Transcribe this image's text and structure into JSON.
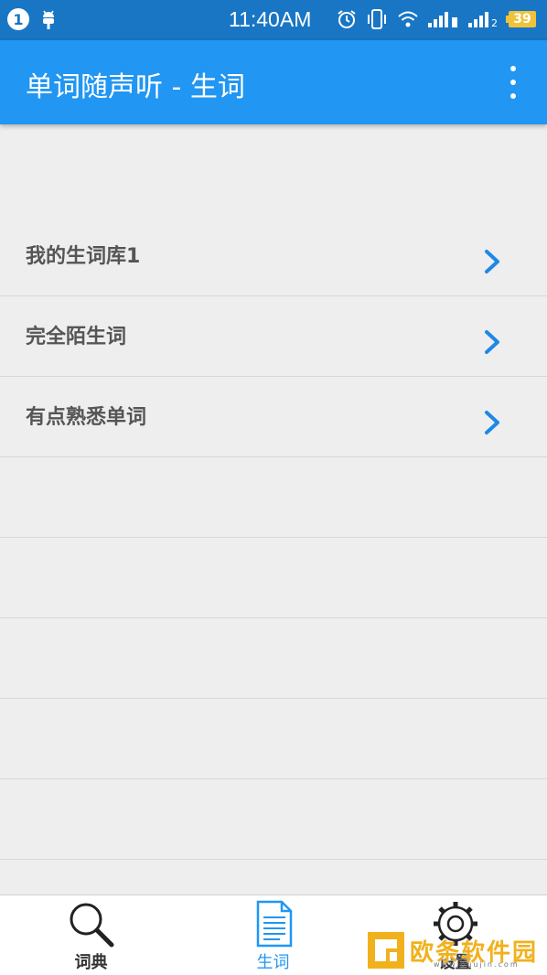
{
  "statusbar": {
    "notification_count": "1",
    "time": "11:40AM",
    "battery": "39",
    "sim2_label": "2",
    "icons": [
      "android-icon",
      "alarm-icon",
      "vibrate-icon",
      "wifi-icon",
      "signal-icon",
      "battery-icon"
    ]
  },
  "appbar": {
    "title": "单词随声听 - 生词",
    "menu_icon": "overflow-menu-icon",
    "background": "#2196f3"
  },
  "list": {
    "items": [
      {
        "label": "我的生词库1"
      },
      {
        "label": "完全陌生词"
      },
      {
        "label": "有点熟悉单词"
      }
    ],
    "chevron_color": "#1e88e5"
  },
  "bottomnav": {
    "tabs": [
      {
        "label": "词典",
        "icon": "search-icon"
      },
      {
        "label": "生词",
        "icon": "document-icon",
        "active": true
      },
      {
        "label": "设置",
        "icon": "gear-icon"
      }
    ]
  },
  "watermark": {
    "text": "欧条软件园",
    "sub": "www.ouujin.com"
  }
}
